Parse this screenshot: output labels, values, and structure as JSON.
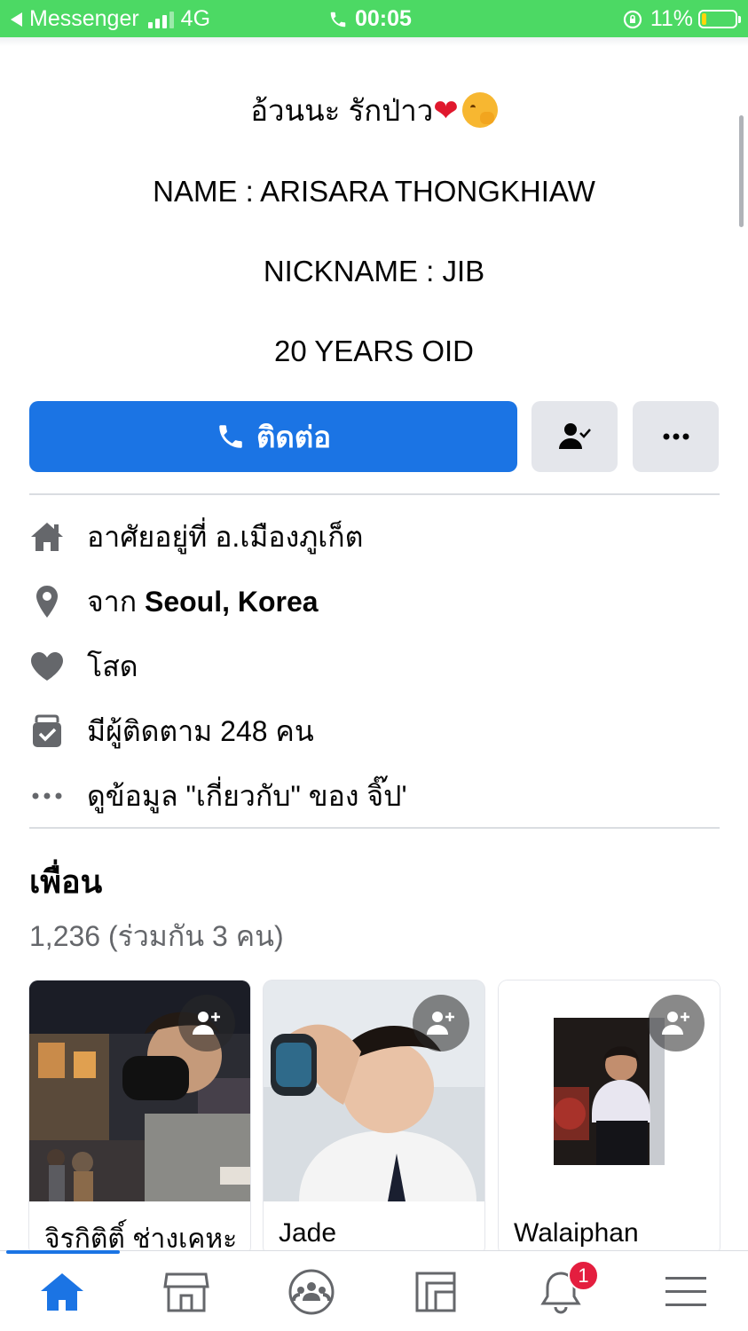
{
  "status_bar": {
    "app_back": "Messenger",
    "network": "4G",
    "time": "00:05",
    "battery": "11%",
    "battery_level": 0.11
  },
  "bio": {
    "line1_text": "อ้วนนะ รักป่าว",
    "line1_heart": "❤",
    "name": "NAME : ARISARA THONGKHIAW",
    "nickname": "NICKNAME : JIB",
    "age": "20 YEARS OID"
  },
  "actions": {
    "contact_label": "ติดต่อ"
  },
  "info": [
    {
      "icon": "home-icon",
      "prefix": "อาศัยอยู่ที่ อ.เมืองภูเก็ต",
      "bold": ""
    },
    {
      "icon": "location-pin-icon",
      "prefix": "จาก ",
      "bold": "Seoul, Korea"
    },
    {
      "icon": "heart-icon",
      "prefix": "โสด",
      "bold": ""
    },
    {
      "icon": "followers-icon",
      "prefix": "มีผู้ติดตาม 248 คน",
      "bold": ""
    },
    {
      "icon": "more-dots-icon",
      "prefix": "ดูข้อมูล \"เกี่ยวกับ\" ของ จิ๊ป'",
      "bold": ""
    }
  ],
  "friends": {
    "title": "เพื่อน",
    "count": "1,236 (ร่วมกัน 3 คน)",
    "items": [
      {
        "name": "จิรกิติติ์ ช่างเคหะ"
      },
      {
        "name": "Jade"
      },
      {
        "name": "Walaiphan"
      }
    ]
  },
  "bottom_nav": {
    "items": [
      "home-icon",
      "marketplace-icon",
      "groups-icon",
      "pages-icon",
      "notifications-icon",
      "menu-icon"
    ],
    "notification_count": "1"
  },
  "colors": {
    "accent": "#1b74e4",
    "status_bar": "#4cd964",
    "badge": "#e41e3f"
  }
}
